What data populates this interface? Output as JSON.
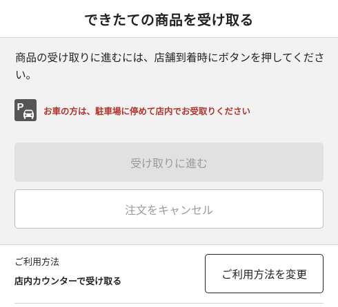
{
  "header": {
    "title": "できたての商品を受け取る"
  },
  "main": {
    "instruction": "商品の受け取りに進むには、店舗到着時にボタンを押してください。",
    "notice": {
      "icon": "parking-car-icon",
      "text": "お車の方は、駐車場に停めて店内でお受取りください",
      "color": "#b5322a"
    },
    "buttons": {
      "proceed_label": "受け取りに進む",
      "cancel_label": "注文をキャンセル"
    }
  },
  "usage": {
    "label": "ご利用方法",
    "value": "店内カウンターで受け取る",
    "change_label": "ご利用方法を変更"
  }
}
